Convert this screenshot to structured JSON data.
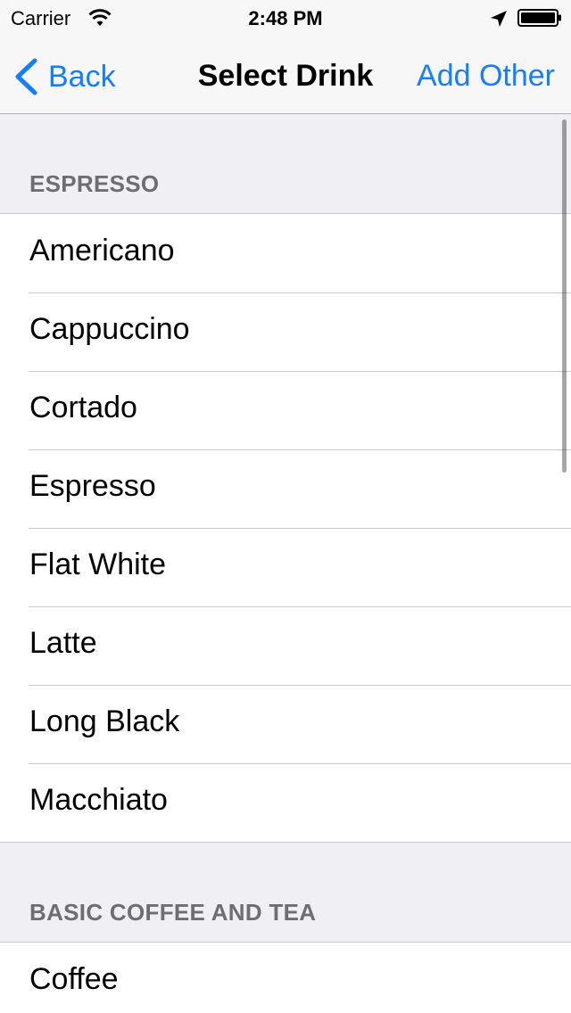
{
  "status_bar": {
    "carrier": "Carrier",
    "time": "2:48 PM",
    "icons": [
      "wifi-icon",
      "location-arrow-icon",
      "battery-icon"
    ]
  },
  "nav": {
    "back_label": "Back",
    "title": "Select Drink",
    "right_label": "Add Other"
  },
  "sections": [
    {
      "header": "ESPRESSO",
      "items": [
        "Americano",
        "Cappuccino",
        "Cortado",
        "Espresso",
        "Flat White",
        "Latte",
        "Long Black",
        "Macchiato"
      ]
    },
    {
      "header": "BASIC COFFEE AND TEA",
      "items": [
        "Coffee"
      ]
    }
  ],
  "colors": {
    "accent": "#157efb",
    "section_header_text": "#6d6d72",
    "background": "#efeff4",
    "separator": "#c8c7cc"
  }
}
